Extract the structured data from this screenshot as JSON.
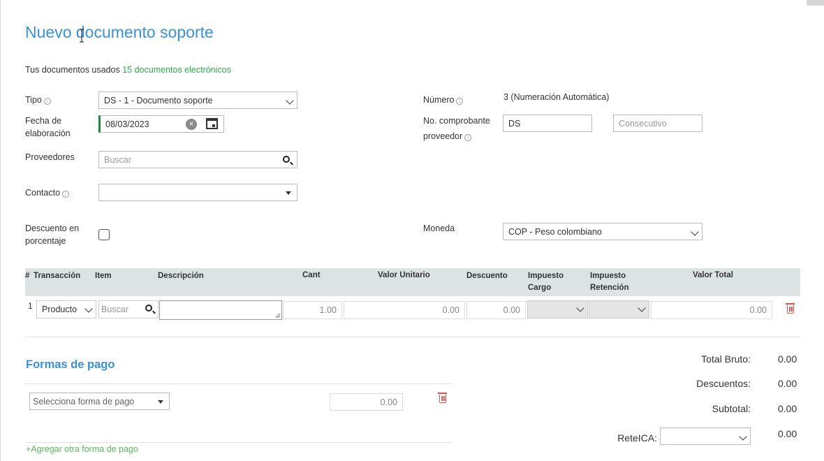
{
  "page": {
    "title": "Nuevo documento soporte",
    "usage_prefix": "Tus documentos usados",
    "usage_count": "15 documentos electrónicos"
  },
  "form": {
    "tipo": {
      "label": "Tipo",
      "value": "DS - 1 - Documento soporte"
    },
    "fecha": {
      "label_line1": "Fecha de",
      "label_line2": "elaboración",
      "value": "08/03/2023"
    },
    "proveedores": {
      "label": "Proveedores",
      "placeholder": "Buscar"
    },
    "contacto": {
      "label": "Contacto",
      "value": ""
    },
    "descuento": {
      "label_line1": "Descuento en",
      "label_line2": "porcentaje",
      "checked": false
    },
    "numero": {
      "label": "Número",
      "value": "3 (Numeración Automática)"
    },
    "comprobante": {
      "label_line1": "No. comprobante",
      "label_line2": "proveedor",
      "prefix_value": "DS",
      "consecutivo_placeholder": "Consecutivo"
    },
    "moneda": {
      "label": "Moneda",
      "value": "COP - Peso colombiano"
    }
  },
  "table": {
    "headers": {
      "num": "#",
      "transaccion": "Transacción",
      "item": "Item",
      "descripcion": "Descripción",
      "cant": "Cant",
      "valor_unitario": "Valor Unitario",
      "descuento": "Descuento",
      "impuesto_cargo_1": "Impuesto",
      "impuesto_cargo_2": "Cargo",
      "impuesto_ret_1": "Impuesto",
      "impuesto_ret_2": "Retención",
      "valor_total": "Valor Total"
    },
    "rows": [
      {
        "index": "1",
        "transaccion": "Producto",
        "item_placeholder": "Buscar",
        "descripcion": "",
        "cant": "1.00",
        "valor_unitario": "0.00",
        "descuento": "0.00",
        "valor_total": "0.00"
      }
    ]
  },
  "payments": {
    "title": "Formas de pago",
    "select_placeholder": "Selecciona forma de pago",
    "amount": "0.00",
    "add_link": "+Agregar otra forma de pago"
  },
  "totals": {
    "bruto_label": "Total Bruto:",
    "bruto_value": "0.00",
    "descuentos_label": "Descuentos:",
    "descuentos_value": "0.00",
    "subtotal_label": "Subtotal:",
    "subtotal_value": "0.00",
    "reteica_label": "ReteICA:",
    "reteica_value": "0.00"
  },
  "icons": {
    "info": "i",
    "clear": "×"
  },
  "colors": {
    "accent_blue": "#3d8fd6",
    "accent_green": "#2eaa4a",
    "danger_red": "#d9534f"
  }
}
